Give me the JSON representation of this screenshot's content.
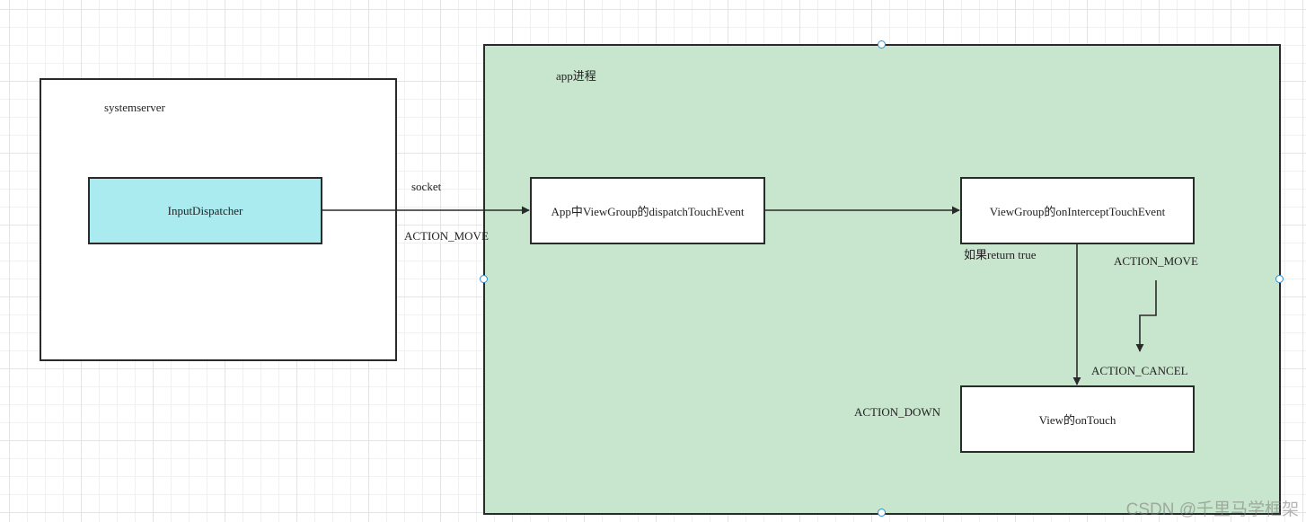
{
  "containers": {
    "systemserver": {
      "label": "systemserver"
    },
    "app_process": {
      "label": "app进程"
    }
  },
  "nodes": {
    "input_dispatcher": "InputDispatcher",
    "dispatch_touch_event": "App中ViewGroup的dispatchTouchEvent",
    "on_intercept_touch_event": "ViewGroup的onInterceptTouchEvent",
    "view_on_touch": "View的onTouch"
  },
  "edge_labels": {
    "socket": "socket",
    "action_move_1": "ACTION_MOVE",
    "return_true": "如果return true",
    "action_move_2": "ACTION_MOVE",
    "action_cancel": "ACTION_CANCEL",
    "action_down": "ACTION_DOWN"
  },
  "watermark": "CSDN @千里马学框架",
  "colors": {
    "app_process_fill": "#c8e6cd",
    "input_dispatcher_fill": "#aaebf0",
    "stroke": "#2a2a2a",
    "selection_handle": "#2b8fd6"
  }
}
